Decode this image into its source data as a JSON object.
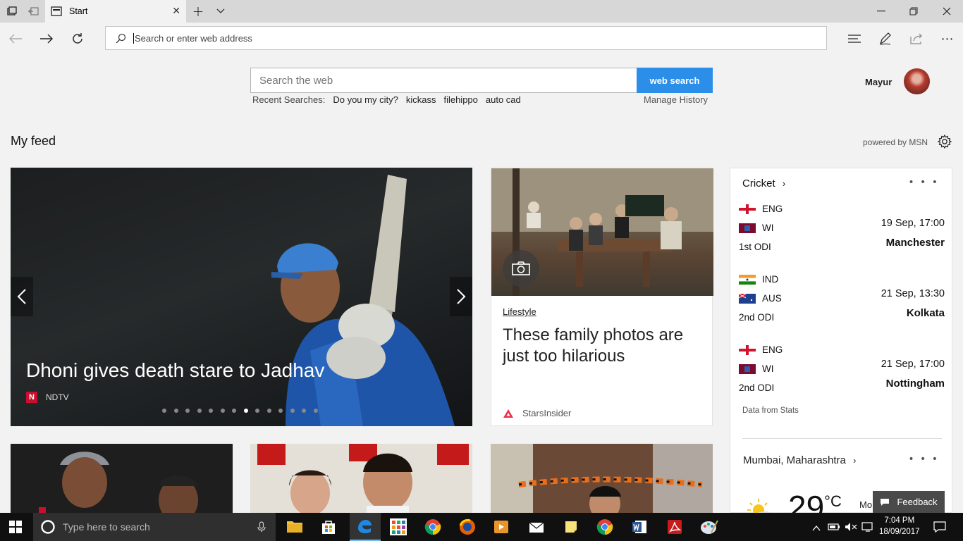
{
  "browser": {
    "tab_title": "Start",
    "address_placeholder": "Search or enter web address"
  },
  "search": {
    "placeholder": "Search the web",
    "button_label": "web search",
    "recent_label": "Recent Searches:",
    "recent_items": [
      "Do you my city?",
      "kickass",
      "filehippo",
      "auto cad"
    ],
    "manage_history": "Manage History"
  },
  "user": {
    "name": "Mayur"
  },
  "feed": {
    "title": "My feed",
    "powered_by": "powered by MSN"
  },
  "hero": {
    "title": "Dhoni gives death stare to Jadhav",
    "source": "NDTV",
    "source_logo_letter": "N",
    "slide_count": 14,
    "active_slide": 7
  },
  "card2": {
    "category": "Lifestyle",
    "title": "These family photos are just too hilarious",
    "source": "StarsInsider"
  },
  "cricket": {
    "title": "Cricket",
    "matches": [
      {
        "team1": "ENG",
        "team2": "WI",
        "series": "1st ODI",
        "date": "19 Sep, 17:00",
        "venue": "Manchester"
      },
      {
        "team1": "IND",
        "team2": "AUS",
        "series": "2nd ODI",
        "date": "21 Sep, 13:30",
        "venue": "Kolkata"
      },
      {
        "team1": "ENG",
        "team2": "WI",
        "series": "2nd ODI",
        "date": "21 Sep, 17:00",
        "venue": "Nottingham"
      }
    ],
    "data_from": "Data from Stats"
  },
  "weather": {
    "location": "Mumbai, Maharashtra",
    "temp": "29",
    "unit": "°C",
    "partial": "Mo"
  },
  "feedback": "Feedback",
  "taskbar": {
    "search_placeholder": "Type here to search",
    "time": "7:04 PM",
    "date": "18/09/2017"
  },
  "colors": {
    "accent": "#2b8ee8",
    "titlebar": "#d7d7d7",
    "taskbar": "#101010"
  }
}
